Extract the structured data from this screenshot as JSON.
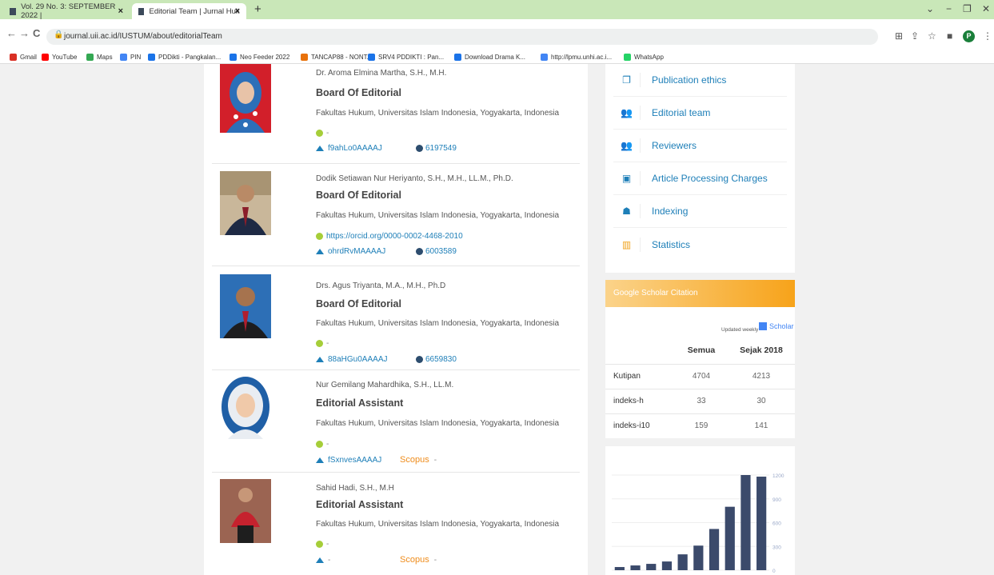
{
  "browser": {
    "tabs": [
      {
        "title": "Vol. 29 No. 3: SEPTEMBER 2022 |",
        "active": false
      },
      {
        "title": "Editorial Team | Jurnal Hukum IUS",
        "active": true
      }
    ],
    "url": "journal.uii.ac.id/IUSTUM/about/editorialTeam",
    "bookmarks": [
      {
        "label": "Gmail",
        "color": "#d93025"
      },
      {
        "label": "YouTube",
        "color": "#ff0000"
      },
      {
        "label": "Maps",
        "color": "#34a853"
      },
      {
        "label": "PIN",
        "color": "#4285f4"
      },
      {
        "label": "PDDikti - Pangkalan...",
        "color": "#1a73e8"
      },
      {
        "label": "Neo Feeder 2022",
        "color": "#1a73e8"
      },
      {
        "label": "TANCAP88 - NONT...",
        "color": "#e8710a"
      },
      {
        "label": "SRV4 PDDIKTI : Pan...",
        "color": "#1a73e8"
      },
      {
        "label": "Download Drama K...",
        "color": "#1a73e8"
      },
      {
        "label": "http://lpmu.unhi.ac.i...",
        "color": "#4285f4"
      },
      {
        "label": "WhatsApp",
        "color": "#25d366"
      }
    ],
    "profile_letter": "P"
  },
  "editorial_team": [
    {
      "name": "Dr. Aroma Elmina Martha, S.H., M.H.",
      "role": "Board Of Editorial",
      "affiliation": "Fakultas Hukum, Universitas Islam Indonesia, Yogyakarta, Indonesia",
      "orcid": "-",
      "scholar_id": "f9ahLo0AAAAJ",
      "sinta_id": "6197549",
      "scopus": ""
    },
    {
      "name": "Dodik Setiawan Nur Heriyanto, S.H., M.H., LL.M., Ph.D.",
      "role": "Board Of Editorial",
      "affiliation": "Fakultas Hukum, Universitas Islam Indonesia, Yogyakarta, Indonesia",
      "orcid": "https://orcid.org/0000-0002-4468-2010",
      "scholar_id": "ohrdRvMAAAAJ",
      "sinta_id": "6003589",
      "scopus": ""
    },
    {
      "name": "Drs. Agus Triyanta, M.A., M.H., Ph.D",
      "role": "Board Of Editorial",
      "affiliation": "Fakultas Hukum, Universitas Islam Indonesia, Yogyakarta, Indonesia",
      "orcid": "-",
      "scholar_id": "88aHGu0AAAAJ",
      "sinta_id": "6659830",
      "scopus": ""
    },
    {
      "name": "Nur Gemilang Mahardhika, S.H., LL.M.",
      "role": "Editorial Assistant",
      "affiliation": "Fakultas Hukum, Universitas Islam Indonesia, Yogyakarta, Indonesia",
      "orcid": "-",
      "scholar_id": "fSxnvesAAAAJ",
      "sinta_id": "",
      "scopus": "Scopus",
      "scopus_value": "-"
    },
    {
      "name": "Sahid Hadi, S.H., M.H",
      "role": "Editorial Assistant",
      "affiliation": "Fakultas Hukum, Universitas Islam Indonesia, Yogyakarta, Indonesia",
      "orcid": "-",
      "scholar_id": "-",
      "sinta_id": "",
      "scopus": "Scopus",
      "scopus_value": "-"
    }
  ],
  "sidebar_menu": [
    {
      "label": "Publication ethics",
      "icon": "copy-icon"
    },
    {
      "label": "Editorial team",
      "icon": "users-icon"
    },
    {
      "label": "Reviewers",
      "icon": "users-icon"
    },
    {
      "label": "Article Processing Charges",
      "icon": "money-icon"
    },
    {
      "label": "Indexing",
      "icon": "sitemap-icon"
    },
    {
      "label": "Statistics",
      "icon": "bar-chart-icon"
    }
  ],
  "scholar": {
    "title": "Google Scholar Citation",
    "updated": "Updated weekly",
    "logo": "Scholar",
    "columns": [
      "",
      "Semua",
      "Sejak 2018"
    ],
    "rows": [
      [
        "Kutipan",
        "4704",
        "4213"
      ],
      [
        "indeks-h",
        "33",
        "30"
      ],
      [
        "indeks-i10",
        "159",
        "141"
      ]
    ]
  },
  "chart_data": {
    "type": "bar",
    "values": [
      40,
      60,
      80,
      110,
      200,
      310,
      520,
      800,
      1200,
      1180
    ],
    "ylim": [
      0,
      1200
    ],
    "yticks": [
      "0",
      "300",
      "600",
      "900",
      "1200"
    ],
    "color": "#3b4a6b"
  }
}
